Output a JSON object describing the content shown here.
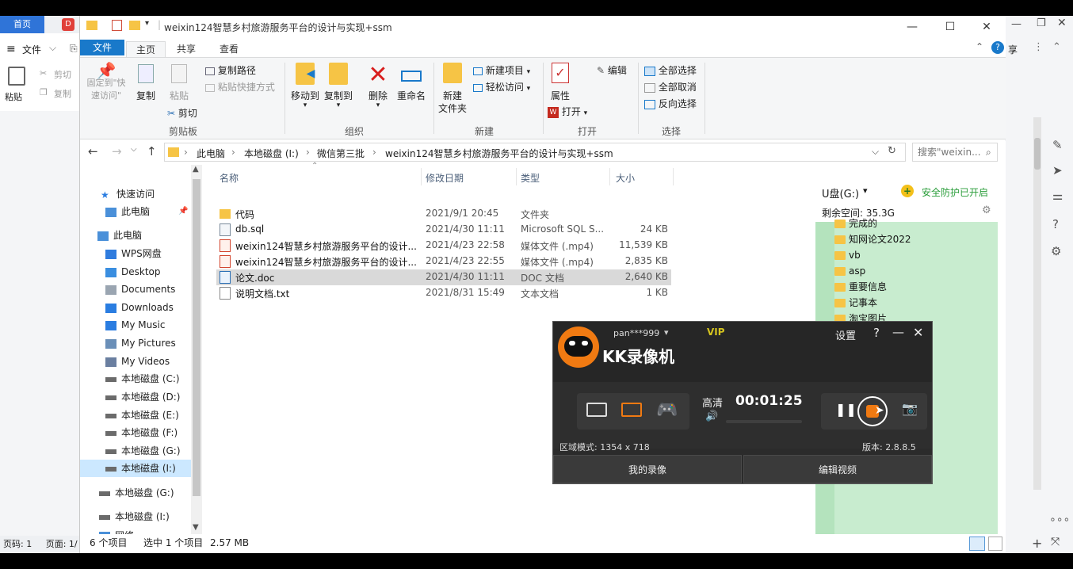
{
  "wps": {
    "tab_home": "首页",
    "menu_file": "文件",
    "tool_paste": "粘贴",
    "tool_cut": "剪切",
    "tool_copy": "复制",
    "right_share": "享",
    "status_page": "页码: 1",
    "status_pages": "页面: 1/"
  },
  "explorer": {
    "title": "weixin124智慧乡村旅游服务平台的设计与实现+ssm",
    "tabs": [
      "文件",
      "主页",
      "共享",
      "查看"
    ],
    "ribbon": {
      "pin_quick": "固定到\"快速访问\"",
      "copy": "复制",
      "paste": "粘贴",
      "copy_path": "复制路径",
      "paste_shortcut": "粘贴快捷方式",
      "cut": "剪切",
      "group_clipboard": "剪贴板",
      "move_to": "移动到",
      "copy_to": "复制到",
      "delete": "删除",
      "rename": "重命名",
      "group_organize": "组织",
      "new_folder": "新建\n文件夹",
      "new_item": "新建项目",
      "easy_access": "轻松访问",
      "group_new": "新建",
      "properties": "属性",
      "open": "打开",
      "edit": "编辑",
      "group_open": "打开",
      "select_all": "全部选择",
      "select_none": "全部取消",
      "invert_select": "反向选择",
      "group_select": "选择"
    },
    "breadcrumb": [
      "此电脑",
      "本地磁盘 (I:)",
      "微信第三批",
      "weixin124智慧乡村旅游服务平台的设计与实现+ssm"
    ],
    "search_placeholder": "搜索\"weixin...",
    "nav": [
      {
        "label": "快速访问",
        "icon": "star-icon"
      },
      {
        "label": "此电脑",
        "icon": "computer-icon"
      },
      {
        "label": "此电脑",
        "icon": "computer-icon"
      },
      {
        "label": "WPS网盘",
        "icon": "cloud-icon"
      },
      {
        "label": "Desktop",
        "icon": "desktop-icon"
      },
      {
        "label": "Documents",
        "icon": "documents-icon"
      },
      {
        "label": "Downloads",
        "icon": "download-icon"
      },
      {
        "label": "My Music",
        "icon": "music-icon"
      },
      {
        "label": "My Pictures",
        "icon": "pictures-icon"
      },
      {
        "label": "My Videos",
        "icon": "videos-icon"
      },
      {
        "label": "本地磁盘 (C:)",
        "icon": "drive-icon"
      },
      {
        "label": "本地磁盘 (D:)",
        "icon": "drive-icon"
      },
      {
        "label": "本地磁盘 (E:)",
        "icon": "drive-icon"
      },
      {
        "label": "本地磁盘 (F:)",
        "icon": "drive-icon"
      },
      {
        "label": "本地磁盘 (G:)",
        "icon": "drive-icon"
      },
      {
        "label": "本地磁盘 (I:)",
        "icon": "drive-icon"
      },
      {
        "label": "本地磁盘 (G:)",
        "icon": "drive-icon"
      },
      {
        "label": "本地磁盘 (I:)",
        "icon": "drive-icon"
      },
      {
        "label": "网络",
        "icon": "network-icon"
      }
    ],
    "columns": {
      "name": "名称",
      "date": "修改日期",
      "type": "类型",
      "size": "大小"
    },
    "files": [
      {
        "name": "代码",
        "date": "2021/9/1 20:45",
        "type": "文件夹",
        "size": "",
        "icon": "folder-icon"
      },
      {
        "name": "db.sql",
        "date": "2021/4/30 11:11",
        "type": "Microsoft SQL S...",
        "size": "24 KB",
        "icon": "sql-file-icon"
      },
      {
        "name": "weixin124智慧乡村旅游服务平台的设计...",
        "date": "2021/4/23 22:58",
        "type": "媒体文件 (.mp4)",
        "size": "11,539 KB",
        "icon": "mp4-file-icon"
      },
      {
        "name": "weixin124智慧乡村旅游服务平台的设计...",
        "date": "2021/4/23 22:55",
        "type": "媒体文件 (.mp4)",
        "size": "2,835 KB",
        "icon": "mp4-file-icon"
      },
      {
        "name": "论文.doc",
        "date": "2021/4/30 11:11",
        "type": "DOC 文档",
        "size": "2,640 KB",
        "icon": "doc-file-icon"
      },
      {
        "name": "说明文档.txt",
        "date": "2021/8/31 15:49",
        "type": "文本文档",
        "size": "1 KB",
        "icon": "txt-file-icon"
      }
    ],
    "status": {
      "count": "6 个项目",
      "selected": "选中 1 个项目",
      "size": "2.57 MB"
    }
  },
  "upanel": {
    "drive": "U盘(G:)",
    "security": "安全防护已开启",
    "free": "剩余空间: 35.3G",
    "folders": [
      "完成的",
      "知网论文2022",
      "vb",
      "asp",
      "重要信息",
      "记事本",
      "淘宝图片"
    ]
  },
  "kk": {
    "user": "pan***999",
    "vip": "VIP",
    "settings": "设置",
    "app_name": "KK录像机",
    "quality": "高清",
    "timer": "00:01:25",
    "region": "区域模式: 1354 x 718",
    "version": "版本: 2.8.8.5",
    "my_recordings": "我的录像",
    "edit_video": "编辑视频"
  },
  "colors": {
    "accent": "#1979ca",
    "selection": "#cce8ff",
    "kk_orange": "#f07a12",
    "security_green": "#2a9d3a"
  }
}
